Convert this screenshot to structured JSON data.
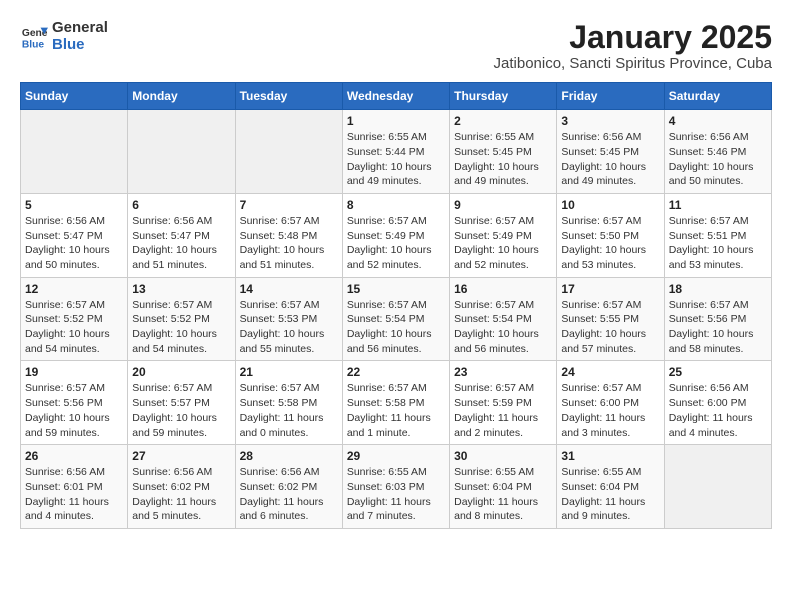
{
  "logo": {
    "general": "General",
    "blue": "Blue"
  },
  "title": "January 2025",
  "subtitle": "Jatibonico, Sancti Spiritus Province, Cuba",
  "days_of_week": [
    "Sunday",
    "Monday",
    "Tuesday",
    "Wednesday",
    "Thursday",
    "Friday",
    "Saturday"
  ],
  "weeks": [
    [
      {
        "day": "",
        "info": ""
      },
      {
        "day": "",
        "info": ""
      },
      {
        "day": "",
        "info": ""
      },
      {
        "day": "1",
        "info": "Sunrise: 6:55 AM\nSunset: 5:44 PM\nDaylight: 10 hours\nand 49 minutes."
      },
      {
        "day": "2",
        "info": "Sunrise: 6:55 AM\nSunset: 5:45 PM\nDaylight: 10 hours\nand 49 minutes."
      },
      {
        "day": "3",
        "info": "Sunrise: 6:56 AM\nSunset: 5:45 PM\nDaylight: 10 hours\nand 49 minutes."
      },
      {
        "day": "4",
        "info": "Sunrise: 6:56 AM\nSunset: 5:46 PM\nDaylight: 10 hours\nand 50 minutes."
      }
    ],
    [
      {
        "day": "5",
        "info": "Sunrise: 6:56 AM\nSunset: 5:47 PM\nDaylight: 10 hours\nand 50 minutes."
      },
      {
        "day": "6",
        "info": "Sunrise: 6:56 AM\nSunset: 5:47 PM\nDaylight: 10 hours\nand 51 minutes."
      },
      {
        "day": "7",
        "info": "Sunrise: 6:57 AM\nSunset: 5:48 PM\nDaylight: 10 hours\nand 51 minutes."
      },
      {
        "day": "8",
        "info": "Sunrise: 6:57 AM\nSunset: 5:49 PM\nDaylight: 10 hours\nand 52 minutes."
      },
      {
        "day": "9",
        "info": "Sunrise: 6:57 AM\nSunset: 5:49 PM\nDaylight: 10 hours\nand 52 minutes."
      },
      {
        "day": "10",
        "info": "Sunrise: 6:57 AM\nSunset: 5:50 PM\nDaylight: 10 hours\nand 53 minutes."
      },
      {
        "day": "11",
        "info": "Sunrise: 6:57 AM\nSunset: 5:51 PM\nDaylight: 10 hours\nand 53 minutes."
      }
    ],
    [
      {
        "day": "12",
        "info": "Sunrise: 6:57 AM\nSunset: 5:52 PM\nDaylight: 10 hours\nand 54 minutes."
      },
      {
        "day": "13",
        "info": "Sunrise: 6:57 AM\nSunset: 5:52 PM\nDaylight: 10 hours\nand 54 minutes."
      },
      {
        "day": "14",
        "info": "Sunrise: 6:57 AM\nSunset: 5:53 PM\nDaylight: 10 hours\nand 55 minutes."
      },
      {
        "day": "15",
        "info": "Sunrise: 6:57 AM\nSunset: 5:54 PM\nDaylight: 10 hours\nand 56 minutes."
      },
      {
        "day": "16",
        "info": "Sunrise: 6:57 AM\nSunset: 5:54 PM\nDaylight: 10 hours\nand 56 minutes."
      },
      {
        "day": "17",
        "info": "Sunrise: 6:57 AM\nSunset: 5:55 PM\nDaylight: 10 hours\nand 57 minutes."
      },
      {
        "day": "18",
        "info": "Sunrise: 6:57 AM\nSunset: 5:56 PM\nDaylight: 10 hours\nand 58 minutes."
      }
    ],
    [
      {
        "day": "19",
        "info": "Sunrise: 6:57 AM\nSunset: 5:56 PM\nDaylight: 10 hours\nand 59 minutes."
      },
      {
        "day": "20",
        "info": "Sunrise: 6:57 AM\nSunset: 5:57 PM\nDaylight: 10 hours\nand 59 minutes."
      },
      {
        "day": "21",
        "info": "Sunrise: 6:57 AM\nSunset: 5:58 PM\nDaylight: 11 hours\nand 0 minutes."
      },
      {
        "day": "22",
        "info": "Sunrise: 6:57 AM\nSunset: 5:58 PM\nDaylight: 11 hours\nand 1 minute."
      },
      {
        "day": "23",
        "info": "Sunrise: 6:57 AM\nSunset: 5:59 PM\nDaylight: 11 hours\nand 2 minutes."
      },
      {
        "day": "24",
        "info": "Sunrise: 6:57 AM\nSunset: 6:00 PM\nDaylight: 11 hours\nand 3 minutes."
      },
      {
        "day": "25",
        "info": "Sunrise: 6:56 AM\nSunset: 6:00 PM\nDaylight: 11 hours\nand 4 minutes."
      }
    ],
    [
      {
        "day": "26",
        "info": "Sunrise: 6:56 AM\nSunset: 6:01 PM\nDaylight: 11 hours\nand 4 minutes."
      },
      {
        "day": "27",
        "info": "Sunrise: 6:56 AM\nSunset: 6:02 PM\nDaylight: 11 hours\nand 5 minutes."
      },
      {
        "day": "28",
        "info": "Sunrise: 6:56 AM\nSunset: 6:02 PM\nDaylight: 11 hours\nand 6 minutes."
      },
      {
        "day": "29",
        "info": "Sunrise: 6:55 AM\nSunset: 6:03 PM\nDaylight: 11 hours\nand 7 minutes."
      },
      {
        "day": "30",
        "info": "Sunrise: 6:55 AM\nSunset: 6:04 PM\nDaylight: 11 hours\nand 8 minutes."
      },
      {
        "day": "31",
        "info": "Sunrise: 6:55 AM\nSunset: 6:04 PM\nDaylight: 11 hours\nand 9 minutes."
      },
      {
        "day": "",
        "info": ""
      }
    ]
  ]
}
